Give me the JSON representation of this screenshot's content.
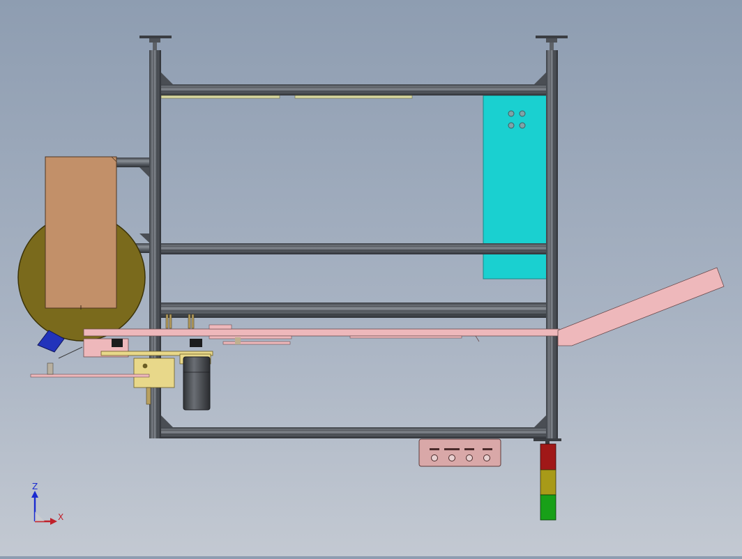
{
  "viewport": {
    "background_top": "#8e9db1",
    "background_bottom": "#c3c9d2"
  },
  "colors": {
    "frame_profile": "#5a5f66",
    "frame_highlight": "#8b9097",
    "cyan_panel": "#1ad0d0",
    "tape_roll": "#7a6a1c",
    "carton_box": "#c29069",
    "conveyor_pink": "#eeb8bb",
    "motor_body": "#4a4d52",
    "bracket_yellow": "#e8d88a",
    "lamp_red": "#a01818",
    "lamp_yellow": "#a89a18",
    "lamp_green": "#18a018",
    "control_box": "#d9a8a8",
    "blue_part": "#2233bb"
  },
  "tower_lamp": {
    "segments": [
      "red",
      "yellow",
      "green"
    ]
  },
  "triad": {
    "z_label": "Z",
    "x_label": "X",
    "z_color": "#1a2bd0",
    "x_color": "#c0202a"
  }
}
